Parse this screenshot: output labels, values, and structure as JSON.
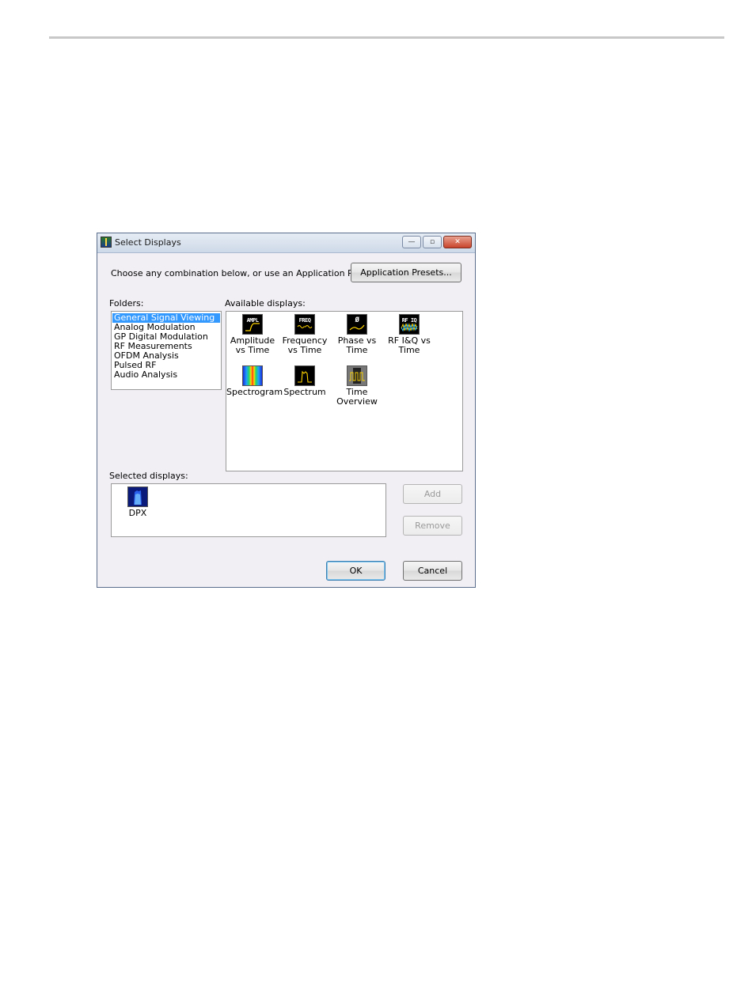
{
  "window": {
    "title": "Select Displays"
  },
  "window_controls": {
    "minimize": "—",
    "maximize": "▫",
    "close": "✕"
  },
  "prompt": "Choose any combination below, or use an Application Preset.",
  "buttons": {
    "presets": "Application Presets...",
    "add": "Add",
    "remove": "Remove",
    "ok": "OK",
    "cancel": "Cancel"
  },
  "folders": {
    "label": "Folders:",
    "items": [
      "General Signal Viewing",
      "Analog Modulation",
      "GP Digital Modulation",
      "RF Measurements",
      "OFDM Analysis",
      "Pulsed RF",
      "Audio Analysis"
    ],
    "selected_index": 0
  },
  "available": {
    "label": "Available displays:",
    "items": [
      {
        "name": "Amplitude vs Time",
        "icon": "amplitude-vs-time-icon",
        "tag": "AMPL"
      },
      {
        "name": "Frequency vs Time",
        "icon": "frequency-vs-time-icon",
        "tag": "FREQ"
      },
      {
        "name": "Phase vs Time",
        "icon": "phase-vs-time-icon",
        "tag": "Ø"
      },
      {
        "name": "RF I&Q vs Time",
        "icon": "rf-iq-vs-time-icon",
        "tag": "RF IQ"
      },
      {
        "name": "Spectrogram",
        "icon": "spectrogram-icon",
        "tag": ""
      },
      {
        "name": "Spectrum",
        "icon": "spectrum-icon",
        "tag": ""
      },
      {
        "name": "Time Overview",
        "icon": "time-overview-icon",
        "tag": ""
      }
    ]
  },
  "selected": {
    "label": "Selected displays:",
    "items": [
      {
        "name": "DPX",
        "icon": "dpx-icon"
      }
    ]
  }
}
